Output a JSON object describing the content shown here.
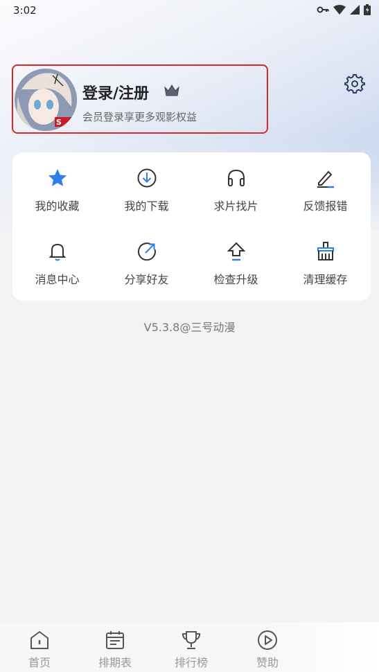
{
  "status_bar": {
    "time": "3:02"
  },
  "profile": {
    "title": "登录/注册",
    "subtitle": "会员登录享更多观影权益"
  },
  "menu": {
    "items": [
      {
        "label": "我的收藏",
        "icon": "star-icon"
      },
      {
        "label": "我的下载",
        "icon": "download-icon"
      },
      {
        "label": "求片找片",
        "icon": "headphones-icon"
      },
      {
        "label": "反馈报错",
        "icon": "edit-icon"
      },
      {
        "label": "消息中心",
        "icon": "bell-icon"
      },
      {
        "label": "分享好友",
        "icon": "share-icon"
      },
      {
        "label": "检查升级",
        "icon": "upgrade-icon"
      },
      {
        "label": "清理缓存",
        "icon": "broom-icon"
      }
    ]
  },
  "version": "V5.3.8@三号动漫",
  "bottom_nav": {
    "items": [
      {
        "label": "首页",
        "icon": "home-icon"
      },
      {
        "label": "排期表",
        "icon": "calendar-icon"
      },
      {
        "label": "排行榜",
        "icon": "trophy-icon"
      },
      {
        "label": "赞助",
        "icon": "play-circle-icon"
      }
    ]
  },
  "colors": {
    "accent_blue": "#2f7ee8",
    "highlight_border": "#d02a2a",
    "text_primary": "#222222",
    "text_secondary": "#666666",
    "nav_inactive": "#999999"
  }
}
